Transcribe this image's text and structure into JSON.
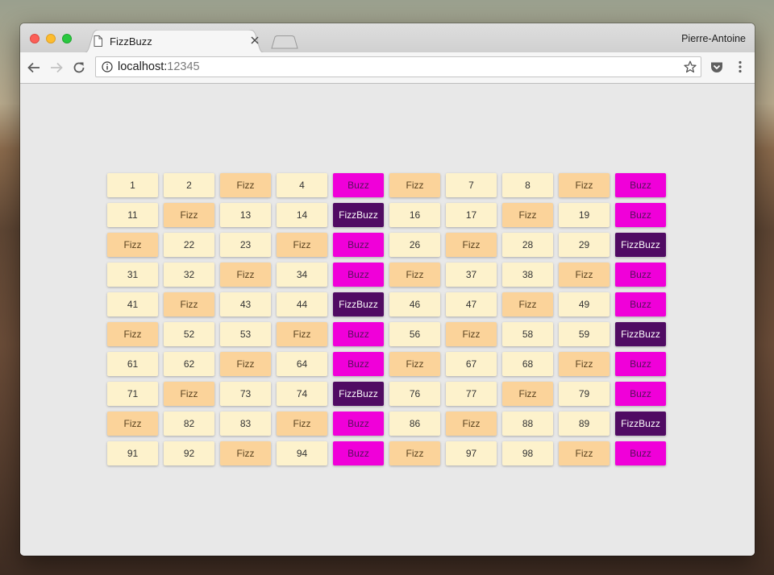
{
  "window": {
    "tab_title": "FizzBuzz",
    "profile_name": "Pierre-Antoine"
  },
  "address_bar": {
    "host": "localhost:",
    "port": "12345"
  },
  "icons": {
    "back": "arrow-left-icon",
    "forward": "arrow-right-icon",
    "reload": "reload-icon",
    "info": "info-icon",
    "bookmark": "star-icon",
    "pocket": "pocket-icon",
    "menu": "kebab-menu-icon",
    "tab": "document-icon",
    "close": "close-icon"
  },
  "colors": {
    "number": "#fdf2cc",
    "fizz": "#fbd39a",
    "buzz": "#f000d9",
    "fizzbuzz": "#500b63"
  },
  "fizzbuzz": {
    "cells": [
      "1",
      "2",
      "Fizz",
      "4",
      "Buzz",
      "Fizz",
      "7",
      "8",
      "Fizz",
      "Buzz",
      "11",
      "Fizz",
      "13",
      "14",
      "FizzBuzz",
      "16",
      "17",
      "Fizz",
      "19",
      "Buzz",
      "Fizz",
      "22",
      "23",
      "Fizz",
      "Buzz",
      "26",
      "Fizz",
      "28",
      "29",
      "FizzBuzz",
      "31",
      "32",
      "Fizz",
      "34",
      "Buzz",
      "Fizz",
      "37",
      "38",
      "Fizz",
      "Buzz",
      "41",
      "Fizz",
      "43",
      "44",
      "FizzBuzz",
      "46",
      "47",
      "Fizz",
      "49",
      "Buzz",
      "Fizz",
      "52",
      "53",
      "Fizz",
      "Buzz",
      "56",
      "Fizz",
      "58",
      "59",
      "FizzBuzz",
      "61",
      "62",
      "Fizz",
      "64",
      "Buzz",
      "Fizz",
      "67",
      "68",
      "Fizz",
      "Buzz",
      "71",
      "Fizz",
      "73",
      "74",
      "FizzBuzz",
      "76",
      "77",
      "Fizz",
      "79",
      "Buzz",
      "Fizz",
      "82",
      "83",
      "Fizz",
      "Buzz",
      "86",
      "Fizz",
      "88",
      "89",
      "FizzBuzz",
      "91",
      "92",
      "Fizz",
      "94",
      "Buzz",
      "Fizz",
      "97",
      "98",
      "Fizz",
      "Buzz"
    ]
  }
}
